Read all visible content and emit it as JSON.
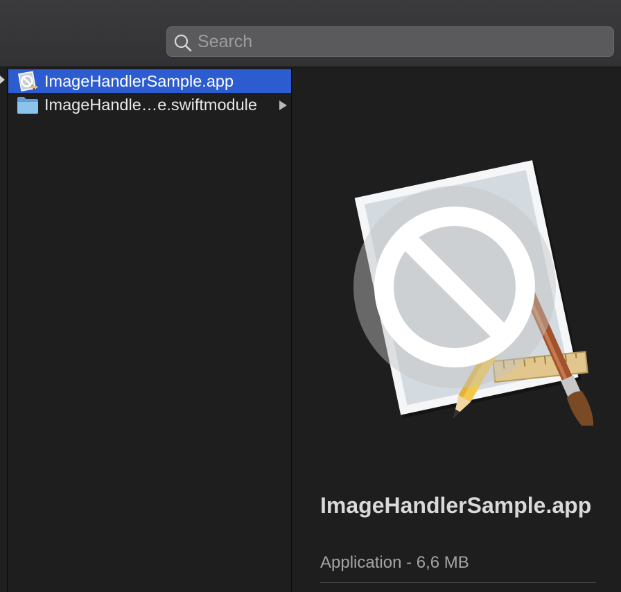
{
  "search": {
    "placeholder": "Search",
    "icon": "search-icon"
  },
  "files": [
    {
      "name": "ImageHandlerSample.app",
      "icon": "app-icon",
      "selected": true,
      "has_children": false
    },
    {
      "name": "ImageHandle…e.swiftmodule",
      "icon": "folder-icon",
      "selected": false,
      "has_children": true
    }
  ],
  "preview": {
    "name": "ImageHandlerSample.app",
    "kind_size": "Application - 6,6 MB",
    "icon": "app-blocked-icon"
  },
  "colors": {
    "selection": "#2c5ccf",
    "background": "#1e1e1f",
    "toolbar": "#38383a"
  }
}
